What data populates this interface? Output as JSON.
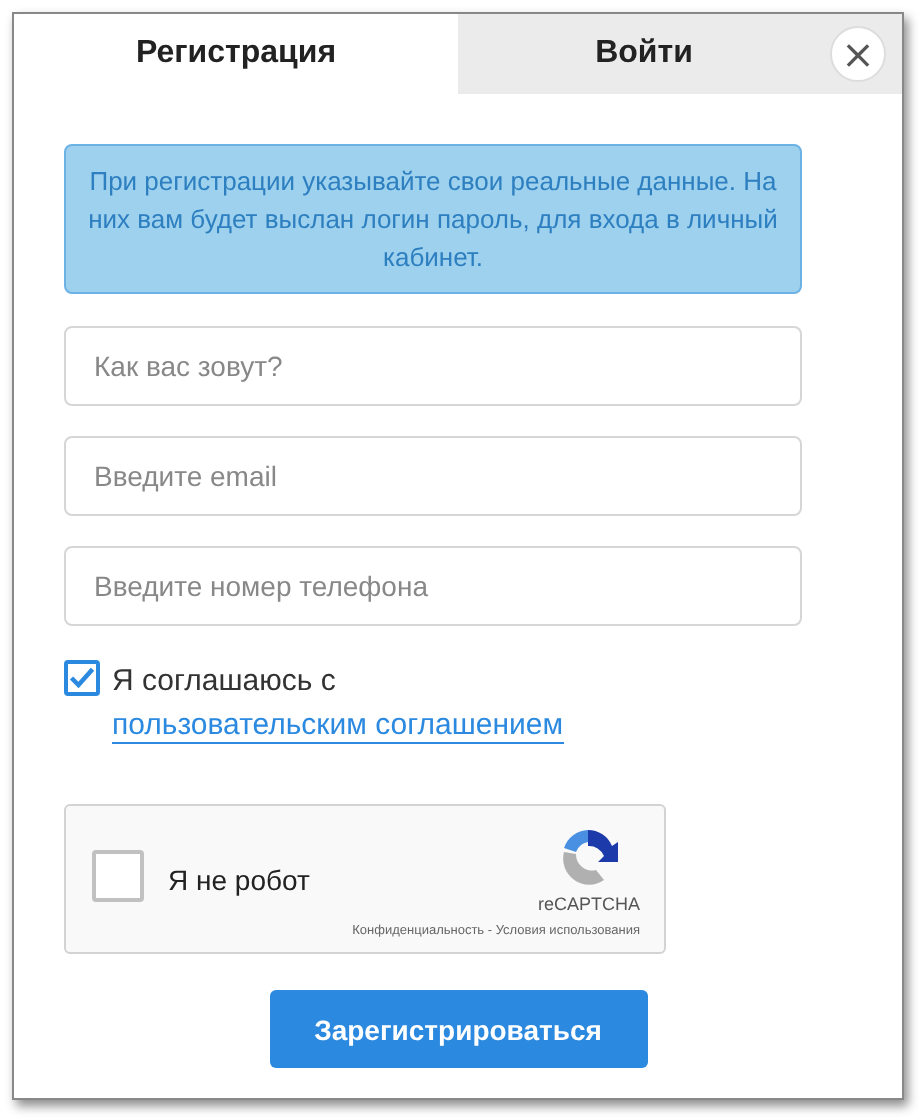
{
  "tabs": [
    {
      "label": "Регистрация",
      "selected": true
    },
    {
      "label": "Войти",
      "selected": false
    }
  ],
  "close": {
    "label": "×"
  },
  "notice": "При регистрации указывайте свои реальные данные. На них вам будет выслан логин пароль, для входа в личный кабинет.",
  "fields": [
    {
      "placeholder": "Как вас зовут?"
    },
    {
      "placeholder": "Введите email"
    },
    {
      "placeholder": "Введите номер телефона"
    }
  ],
  "agreement": {
    "checked": true,
    "text": "Я соглашаюсь с",
    "link": "пользовательским соглашением"
  },
  "captcha": {
    "checked": false,
    "label": "Я не робот",
    "brand": "reCAPTCHA",
    "legal": "Конфиденциальность - Условия использования"
  },
  "submit": "Зарегистрироваться"
}
